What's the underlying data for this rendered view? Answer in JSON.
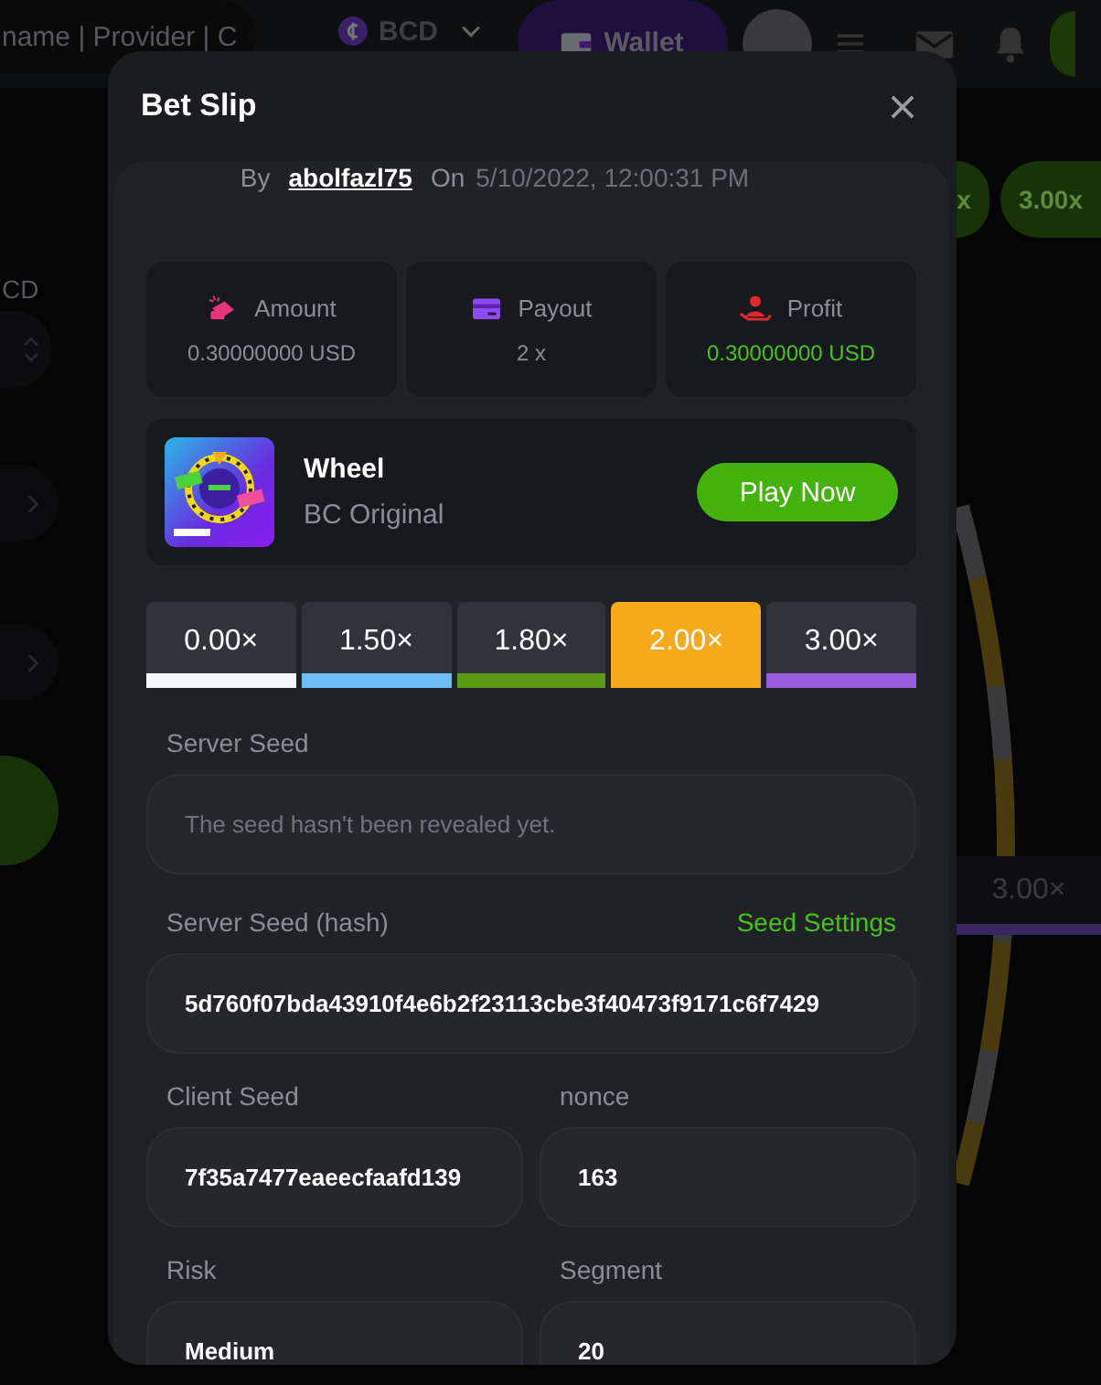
{
  "background": {
    "search_text": "name | Provider | C",
    "currency": "BCD",
    "wallet_button": "Wallet",
    "side_label": "CD",
    "pills": [
      "x",
      "3.00x"
    ],
    "tile": {
      "label": "3.00×",
      "color": "#3a2660"
    }
  },
  "modal": {
    "title": "Bet Slip",
    "by_label": "By",
    "user": "abolfazl75",
    "on_label": "On",
    "date": "5/10/2022, 12:00:31 PM",
    "stats": [
      {
        "kind": "amount",
        "label": "Amount",
        "value": "0.30000000 USD"
      },
      {
        "kind": "payout",
        "label": "Payout",
        "value": "2 x"
      },
      {
        "kind": "profit",
        "label": "Profit",
        "value": "0.30000000 USD"
      }
    ],
    "game": {
      "name": "Wheel",
      "provider": "BC Original",
      "button": "Play Now"
    },
    "multipliers": [
      {
        "label": "0.00×",
        "color": "#f5f7fa",
        "selected": false
      },
      {
        "label": "1.50×",
        "color": "#6bbcf7",
        "selected": false
      },
      {
        "label": "1.80×",
        "color": "#5a9a12",
        "selected": false
      },
      {
        "label": "2.00×",
        "color": "#f5a91b",
        "selected": true
      },
      {
        "label": "3.00×",
        "color": "#9a5ce0",
        "selected": false
      }
    ],
    "server_seed": {
      "label": "Server Seed",
      "placeholder": "The seed hasn't been revealed yet."
    },
    "server_seed_hash": {
      "label": "Server Seed (hash)",
      "link": "Seed Settings",
      "value": "5d760f07bda43910f4e6b2f23113cbe3f40473f9171c6f7429"
    },
    "pairs": [
      [
        {
          "label": "Client Seed",
          "value": "7f35a7477eaeecfaafd139"
        },
        {
          "label": "nonce",
          "value": "163"
        }
      ],
      [
        {
          "label": "Risk",
          "value": "Medium"
        },
        {
          "label": "Segment",
          "value": "20"
        }
      ]
    ]
  }
}
